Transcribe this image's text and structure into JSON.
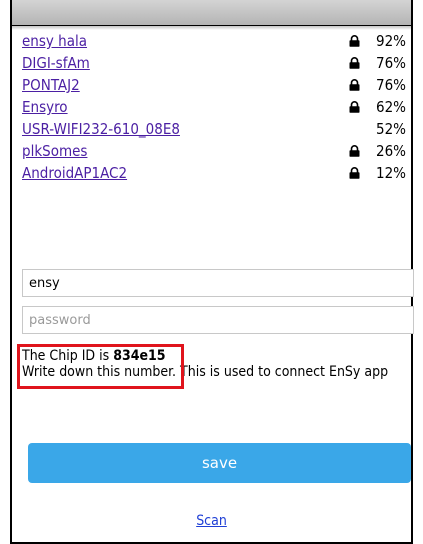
{
  "window": {
    "title": ""
  },
  "networks": [
    {
      "ssid": "ensy hala",
      "locked": true,
      "signal": "92%"
    },
    {
      "ssid": "DIGI-sfAm",
      "locked": true,
      "signal": "76%"
    },
    {
      "ssid": "PONTAJ2",
      "locked": true,
      "signal": "76%"
    },
    {
      "ssid": "Ensyro",
      "locked": true,
      "signal": "62%"
    },
    {
      "ssid": "USR-WIFI232-610_08E8",
      "locked": false,
      "signal": "52%"
    },
    {
      "ssid": "plkSomes",
      "locked": true,
      "signal": "26%"
    },
    {
      "ssid": "AndroidAP1AC2",
      "locked": true,
      "signal": "12%"
    }
  ],
  "form": {
    "ssid_value": "ensy",
    "password_placeholder": "password"
  },
  "chip": {
    "id_prefix": "The Chip ID is ",
    "id_value": "834e15",
    "note_highlighted": "Write down this number.",
    "note_rest": " This is used to connect EnSy app"
  },
  "actions": {
    "save_label": "save",
    "scan_label": "Scan"
  },
  "colors": {
    "link": "#4b1fa3",
    "save_button": "#3aa7e8",
    "highlight_border": "#e0141c",
    "scan_link": "#1f3fd6"
  },
  "icons": {
    "lock": "lock-icon"
  }
}
